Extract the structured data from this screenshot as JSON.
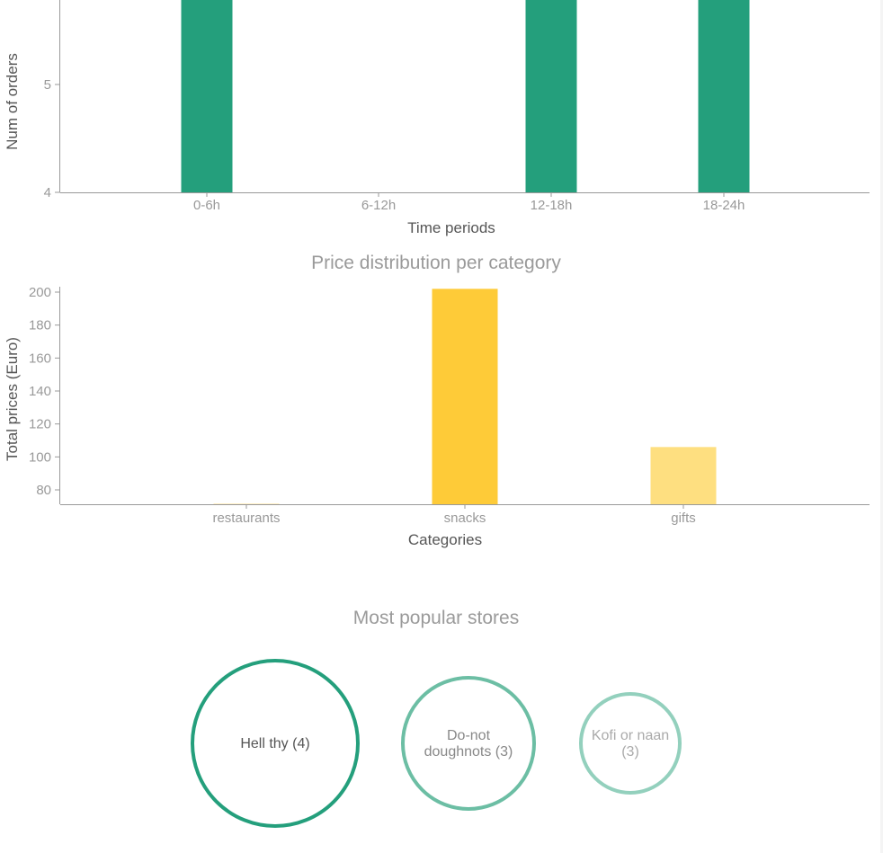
{
  "chart_data": [
    {
      "type": "bar",
      "title": "",
      "xlabel": "Time periods",
      "ylabel": "Num of orders",
      "categories": [
        "0-6h",
        "6-12h",
        "12-18h",
        "18-24h"
      ],
      "values": [
        6,
        4,
        6,
        6
      ],
      "ylim": [
        4,
        5.8
      ],
      "yticks": [
        4,
        5
      ],
      "color": "#249f7c",
      "grid": false
    },
    {
      "type": "bar",
      "title": "Price distribution per category",
      "xlabel": "Categories",
      "ylabel": "Total prices (Euro)",
      "categories": [
        "restaurants",
        "snacks",
        "gifts"
      ],
      "values": [
        71,
        202,
        106
      ],
      "ylim": [
        71,
        200
      ],
      "yticks": [
        80,
        100,
        120,
        140,
        160,
        180,
        200
      ],
      "colors": [
        "#fff0c4",
        "#fecb38",
        "#fedf80"
      ],
      "grid": false
    },
    {
      "type": "bubble",
      "title": "Most popular stores",
      "items": [
        {
          "label": "Hell thy (4)",
          "lines": [
            "Hell thy (4)"
          ],
          "value": 4,
          "color": "#249f7c",
          "text_color": "#555555"
        },
        {
          "label": "Do-not doughnots (3)",
          "lines": [
            "Do-not",
            "doughnots (3)"
          ],
          "value": 3,
          "color": "#6cbea4",
          "text_color": "#888888"
        },
        {
          "label": "Kofi or naan (3)",
          "lines": [
            "Kofi or naan",
            "(3)"
          ],
          "value": 3,
          "color": "#93d0bd",
          "text_color": "#aaaaaa"
        }
      ]
    }
  ]
}
